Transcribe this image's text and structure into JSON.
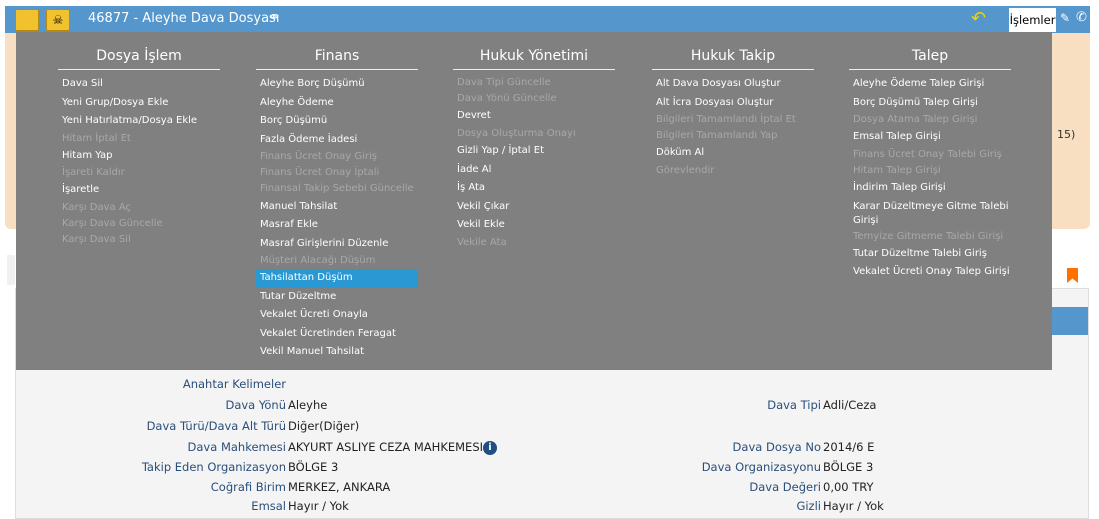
{
  "header": {
    "title": "46877 - Aleyhe Dava Dosyası",
    "actions_label": "İşlemler"
  },
  "colors": {
    "header": "#5596cc",
    "menu_bg": "#808080",
    "selected": "#2a98d3",
    "panel": "#f9dfc2",
    "bookmark": "#ff7000"
  },
  "beige_fragment": "15)",
  "menu": {
    "columns": [
      {
        "title": "Dosya İşlem",
        "items": [
          {
            "label": "Dava Sil",
            "enabled": true
          },
          {
            "label": "Yeni Grup/Dosya Ekle",
            "enabled": true
          },
          {
            "label": "Yeni Hatırlatma/Dosya Ekle",
            "enabled": true
          },
          {
            "label": "Hitam İptal Et",
            "enabled": false
          },
          {
            "label": "Hitam Yap",
            "enabled": true
          },
          {
            "label": "İşareti Kaldır",
            "enabled": false
          },
          {
            "label": "İşaretle",
            "enabled": true
          },
          {
            "label": "Karşı Dava Aç",
            "enabled": false
          },
          {
            "label": "Karşı Dava Güncelle",
            "enabled": false
          },
          {
            "label": "Karşı Dava Sil",
            "enabled": false
          }
        ]
      },
      {
        "title": "Finans",
        "items": [
          {
            "label": "Aleyhe Borç Düşümü",
            "enabled": true
          },
          {
            "label": "Aleyhe Ödeme",
            "enabled": true
          },
          {
            "label": "Borç Düşümü",
            "enabled": true
          },
          {
            "label": "Fazla Ödeme İadesi",
            "enabled": true
          },
          {
            "label": "Finans Ücret Onay Giriş",
            "enabled": false
          },
          {
            "label": "Finans Ücret Onay İptali",
            "enabled": false
          },
          {
            "label": "Finansal Takip Sebebi Güncelle",
            "enabled": false
          },
          {
            "label": "Manuel Tahsilat",
            "enabled": true
          },
          {
            "label": "Masraf Ekle",
            "enabled": true
          },
          {
            "label": "Masraf Girişlerini Düzenle",
            "enabled": true
          },
          {
            "label": "Müşteri Alacağı Düşüm",
            "enabled": false
          },
          {
            "label": "Tahsilattan Düşüm",
            "enabled": true,
            "selected": true
          },
          {
            "label": "Tutar Düzeltme",
            "enabled": true
          },
          {
            "label": "Vekalet Ücreti Onayla",
            "enabled": true
          },
          {
            "label": "Vekalet Ücretinden Feragat",
            "enabled": true
          },
          {
            "label": "Vekil Manuel Tahsilat",
            "enabled": true
          }
        ]
      },
      {
        "title": "Hukuk Yönetimi",
        "items": [
          {
            "label": "Dava Tipi Güncelle",
            "enabled": false
          },
          {
            "label": "Dava Yönü Güncelle",
            "enabled": false
          },
          {
            "label": "Devret",
            "enabled": true
          },
          {
            "label": "Dosya Oluşturma Onayı",
            "enabled": false
          },
          {
            "label": "Gizli Yap / İptal Et",
            "enabled": true
          },
          {
            "label": "İade Al",
            "enabled": true
          },
          {
            "label": "İş Ata",
            "enabled": true
          },
          {
            "label": "Vekil Çıkar",
            "enabled": true
          },
          {
            "label": "Vekil Ekle",
            "enabled": true
          },
          {
            "label": "Vekile Ata",
            "enabled": false
          }
        ]
      },
      {
        "title": "Hukuk Takip",
        "items": [
          {
            "label": "Alt Dava Dosyası Oluştur",
            "enabled": true
          },
          {
            "label": "Alt İcra Dosyası Oluştur",
            "enabled": true
          },
          {
            "label": "Bilgileri Tamamlandı İptal Et",
            "enabled": false
          },
          {
            "label": "Bilgileri Tamamlandı Yap",
            "enabled": false
          },
          {
            "label": "Döküm Al",
            "enabled": true
          },
          {
            "label": "Görevlendir",
            "enabled": false
          }
        ]
      },
      {
        "title": "Talep",
        "items": [
          {
            "label": "Aleyhe Ödeme Talep Girişi",
            "enabled": true
          },
          {
            "label": "Borç Düşümü Talep Girişi",
            "enabled": true
          },
          {
            "label": "Dosya Atama Talep Girişi",
            "enabled": false
          },
          {
            "label": "Emsal Talep Girişi",
            "enabled": true
          },
          {
            "label": "Finans Ücret Onay Talebi Giriş",
            "enabled": false
          },
          {
            "label": "Hitam Talep Girişi",
            "enabled": false
          },
          {
            "label": "İndirim Talep Girişi",
            "enabled": true
          },
          {
            "label": "Karar Düzeltmeye Gitme Talebi Girişi",
            "enabled": true,
            "wrap": true
          },
          {
            "label": "Temyize Gitmeme Talebi Girişi",
            "enabled": false
          },
          {
            "label": "Tutar Düzeltme Talebi Giriş",
            "enabled": true
          },
          {
            "label": "Vekalet Ücreti Onay Talep Girişi",
            "enabled": true
          }
        ]
      }
    ]
  },
  "details": {
    "left": [
      {
        "label": "Anahtar Kelimeler",
        "value": ""
      },
      {
        "label": "Dava Yönü",
        "value": "Aleyhe"
      },
      {
        "label": "Dava Türü/Dava Alt Türü",
        "value": "Diğer(Diğer)"
      },
      {
        "label": "Dava Mahkemesi",
        "value": "AKYURT ASLIYE CEZA MAHKEMESI"
      },
      {
        "label": "Takip Eden Organizasyon",
        "value": "BÖLGE 3"
      },
      {
        "label": "Coğrafi Birim",
        "value": "MERKEZ, ANKARA"
      },
      {
        "label": "Emsal",
        "value": "Hayır / Yok"
      }
    ],
    "right": [
      {
        "label": "Dava Tipi",
        "value": "Adli/Ceza"
      },
      {
        "label": "Dava Dosya No",
        "value": "2014/6   E"
      },
      {
        "label": "Dava Organizasyonu",
        "value": "BÖLGE 3"
      },
      {
        "label": "Dava Değeri",
        "value": "0,00 TRY"
      },
      {
        "label": "Gizli",
        "value": "Hayır / Yok"
      }
    ]
  }
}
